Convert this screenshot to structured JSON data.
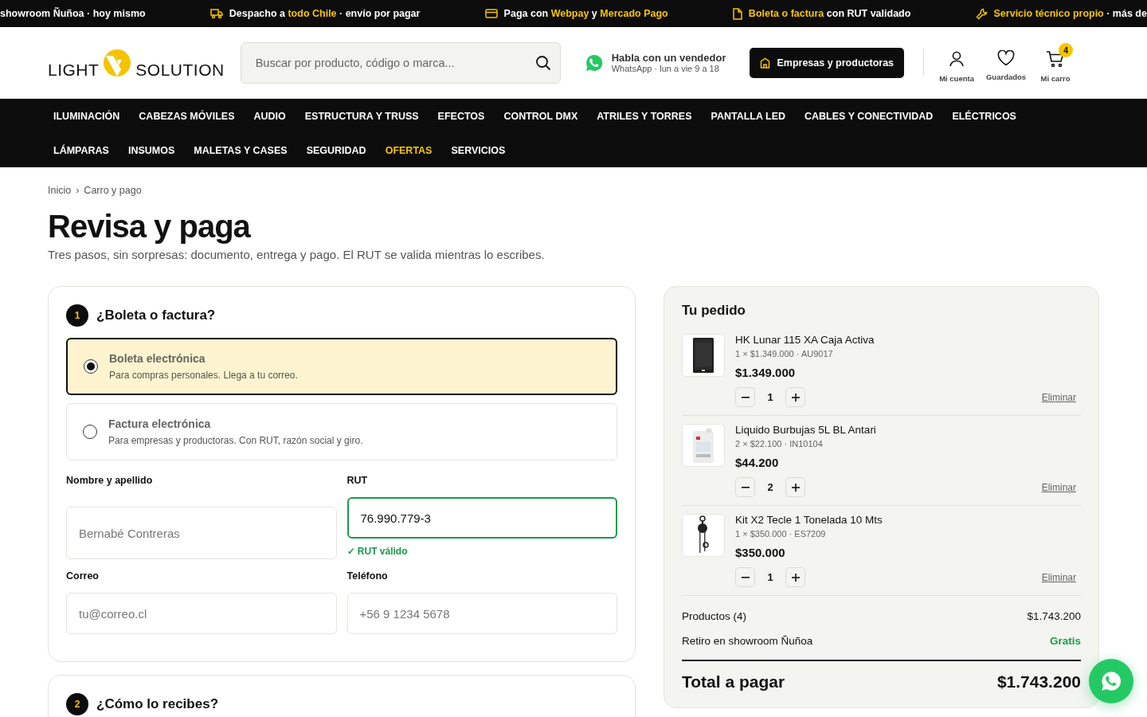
{
  "promo_strip": [
    {
      "text": "showroom Ñuñoa · hoy mismo"
    },
    {
      "text": "Despacho a **todo Chile** · envío por pagar"
    },
    {
      "text": "Paga con **Webpay** y **Mercado Pago**"
    },
    {
      "text": "**Boleta o factura** con RUT validado"
    },
    {
      "text": "**Servicio técnico propio** · más de"
    }
  ],
  "header": {
    "logo": {
      "left": "LIGHT",
      "right": "SOLUTION"
    },
    "search": {
      "placeholder": "Buscar por producto, código o marca..."
    },
    "contact": {
      "title": "Habla con un vendedor",
      "subtitle": "WhatsApp · lun a vie 9 a 18"
    },
    "business_button": "Empresas y productoras",
    "actions": [
      {
        "label": "Mi cuenta"
      },
      {
        "label": "Guardados"
      },
      {
        "label": "Mi carro",
        "badge": "4"
      }
    ]
  },
  "nav": {
    "items": [
      {
        "label": "ILUMINACIÓN",
        "highlight": false
      },
      {
        "label": "CABEZAS MÓVILES",
        "highlight": false
      },
      {
        "label": "AUDIO",
        "highlight": false
      },
      {
        "label": "ESTRUCTURA Y TRUSS",
        "highlight": false
      },
      {
        "label": "EFECTOS",
        "highlight": false
      },
      {
        "label": "CONTROL DMX",
        "highlight": false
      },
      {
        "label": "ATRILES Y TORRES",
        "highlight": false
      },
      {
        "label": "PANTALLA LED",
        "highlight": false
      },
      {
        "label": "CABLES Y CONECTIVIDAD",
        "highlight": false
      },
      {
        "label": "ELÉCTRICOS",
        "highlight": false
      },
      {
        "label": "LÁMPARAS",
        "highlight": false
      },
      {
        "label": "INSUMOS",
        "highlight": false
      },
      {
        "label": "MALETAS Y CASES",
        "highlight": false
      },
      {
        "label": "SEGURIDAD",
        "highlight": false
      },
      {
        "label": "OFERTAS",
        "highlight": true
      },
      {
        "label": "SERVICIOS",
        "highlight": false
      }
    ]
  },
  "breadcrumb": [
    {
      "label": "Inicio"
    },
    {
      "label": "Carro y pago"
    }
  ],
  "breadcrumb_separator": "›",
  "title": "Revisa y paga",
  "subtitle": "Tres pasos, sin sorpresas: documento, entrega y pago. El RUT se valida mientras lo escribes.",
  "steps": [
    {
      "number": "1",
      "title": "¿Boleta o factura?",
      "options": [
        {
          "title": "Boleta electrónica",
          "description": "Para compras personales. Llega a tu correo.",
          "selected": true
        },
        {
          "title": "Factura electrónica",
          "description": "Para empresas y productoras. Con RUT, razón social y giro.",
          "selected": false
        }
      ],
      "fields": [
        {
          "label": "Nombre y apellido",
          "placeholder": "Bernabé Contreras",
          "valid": false
        },
        {
          "label": "RUT",
          "value": "76.990.779-3",
          "valid": true,
          "hint": "✓ RUT válido"
        },
        {
          "label": "Correo",
          "placeholder": "tu@correo.cl",
          "valid": false
        },
        {
          "label": "Teléfono",
          "placeholder": "+56 9 1234 5678",
          "valid": false
        }
      ]
    },
    {
      "number": "2",
      "title": "¿Cómo lo recibes?"
    }
  ],
  "order": {
    "title": "Tu pedido",
    "items": [
      {
        "name": "HK Lunar 115 XA Caja Activa",
        "meta": "1 × $1.349.000 · AU9017",
        "price": "$1.349.000",
        "quantity": "1",
        "remove": "Eliminar",
        "kind": "picture"
      },
      {
        "name": "Liquido Burbujas 5L BL Antari",
        "meta": "2 × $22.100 · IN10104",
        "price": "$44.200",
        "quantity": "2",
        "remove": "Eliminar",
        "kind": "picture"
      },
      {
        "name": "Kit X2 Tecle 1 Tonelada 10 Mts",
        "meta": "1 × $350.000 · ES7209",
        "price": "$350.000",
        "quantity": "1",
        "remove": "Eliminar",
        "kind": "picture"
      }
    ],
    "summary": [
      {
        "label": "Productos (4)",
        "value": "$1.743.200",
        "highlight": false
      },
      {
        "label": "Retiro en showroom Ñuñoa",
        "value": "Gratis",
        "highlight": true
      }
    ],
    "total": {
      "label": "Total a pagar",
      "value": "$1.743.200"
    }
  }
}
